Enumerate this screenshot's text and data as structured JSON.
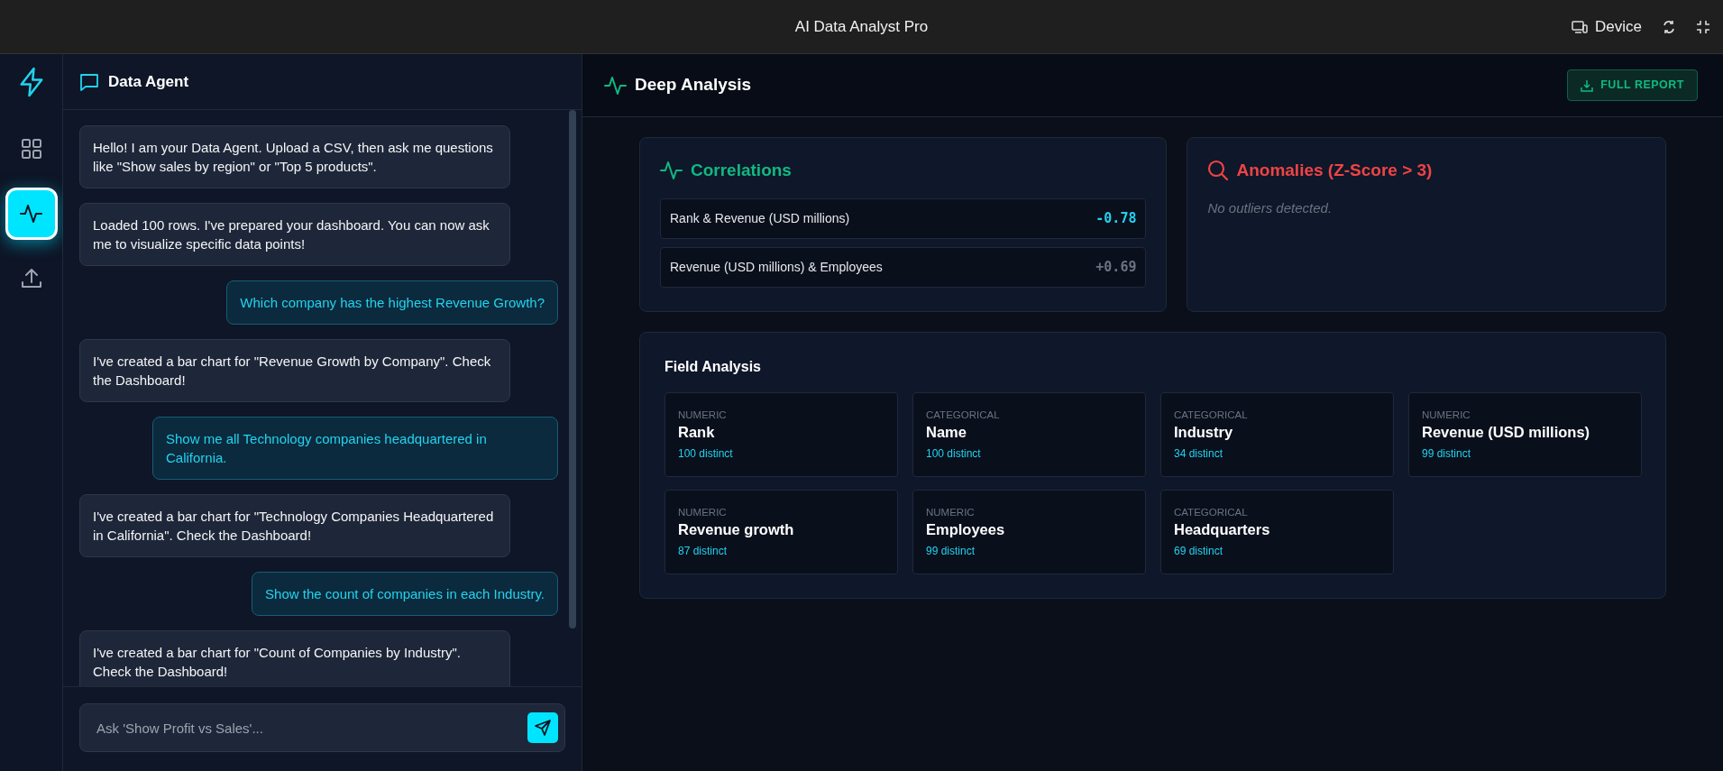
{
  "window": {
    "title": "AI Data Analyst Pro",
    "device_label": "Device"
  },
  "rail": {
    "items": [
      {
        "kind": "grid",
        "selected": false
      },
      {
        "kind": "activity",
        "selected": true
      },
      {
        "kind": "upload",
        "selected": false
      }
    ]
  },
  "chat": {
    "title": "Data Agent",
    "messages": [
      {
        "kind": "bot",
        "text": "Hello! I am your Data Agent. Upload a CSV, then ask me questions like \"Show sales by region\" or \"Top 5 products\"."
      },
      {
        "kind": "bot",
        "text": "Loaded 100 rows. I've prepared your dashboard. You can now ask me to visualize specific data points!"
      },
      {
        "kind": "user",
        "text": "Which company has the highest Revenue Growth?"
      },
      {
        "kind": "bot",
        "text": "I've created a bar chart for \"Revenue Growth by Company\". Check the Dashboard!"
      },
      {
        "kind": "user",
        "text": "Show me all Technology companies headquartered in California."
      },
      {
        "kind": "bot",
        "text": "I've created a bar chart for \"Technology Companies Headquartered in California\". Check the Dashboard!"
      },
      {
        "kind": "user",
        "text": "Show the count of companies in each Industry."
      },
      {
        "kind": "bot",
        "text": "I've created a bar chart for \"Count of Companies by Industry\". Check the Dashboard!"
      }
    ],
    "input": {
      "placeholder": "Ask 'Show Profit vs Sales'..."
    }
  },
  "analysis": {
    "title": "Deep Analysis",
    "report_button": "FULL REPORT",
    "correlations": {
      "title": "Correlations",
      "items": [
        {
          "label": "Rank & Revenue (USD millions)",
          "value": "-0.78",
          "highlighted": true
        },
        {
          "label": "Revenue (USD millions) & Employees",
          "value": "+0.69",
          "highlighted": false
        }
      ]
    },
    "anomalies": {
      "title": "Anomalies (Z-Score > 3)",
      "message": "No outliers detected."
    },
    "fields": {
      "title": "Field Analysis",
      "items": [
        {
          "type": "NUMERIC",
          "name": "Rank",
          "distinct": "100 distinct"
        },
        {
          "type": "CATEGORICAL",
          "name": "Name",
          "distinct": "100 distinct"
        },
        {
          "type": "CATEGORICAL",
          "name": "Industry",
          "distinct": "34 distinct"
        },
        {
          "type": "NUMERIC",
          "name": "Revenue (USD millions)",
          "distinct": "99 distinct"
        },
        {
          "type": "NUMERIC",
          "name": "Revenue growth",
          "distinct": "87 distinct"
        },
        {
          "type": "NUMERIC",
          "name": "Employees",
          "distinct": "99 distinct"
        },
        {
          "type": "CATEGORICAL",
          "name": "Headquarters",
          "distinct": "69 distinct"
        }
      ]
    }
  }
}
